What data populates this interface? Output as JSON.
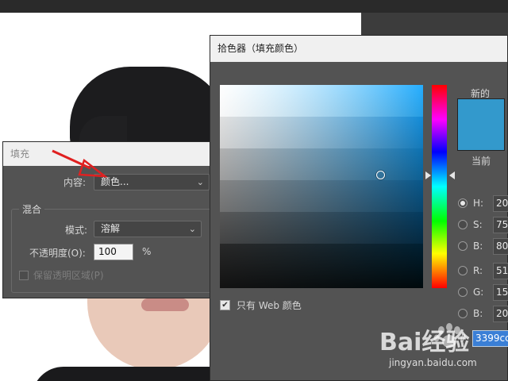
{
  "fill_dialog": {
    "title": "填充",
    "content_label": "内容:",
    "content_value": "颜色...",
    "blend_group": "混合",
    "mode_label": "模式:",
    "mode_value": "溶解",
    "opacity_label": "不透明度(O):",
    "opacity_value": "100",
    "opacity_unit": "%",
    "preserve_label": "保留透明区域(P)"
  },
  "color_picker": {
    "title": "拾色器（填充颜色）",
    "new_label": "新的",
    "current_label": "当前",
    "new_color": "#3399cc",
    "fields": [
      {
        "label": "H:",
        "value": "20",
        "selected": true
      },
      {
        "label": "S:",
        "value": "75",
        "selected": false
      },
      {
        "label": "B:",
        "value": "80",
        "selected": false
      },
      {
        "label": "R:",
        "value": "51",
        "selected": false
      },
      {
        "label": "G:",
        "value": "15",
        "selected": false
      },
      {
        "label": "B:",
        "value": "20",
        "selected": false
      }
    ],
    "web_only_label": "只有 Web 颜色",
    "web_only_checked": true,
    "hash": "#",
    "hex_value": "3399cc"
  },
  "watermark": {
    "brand": "Bai经验",
    "url": "jingyan.baidu.com"
  }
}
